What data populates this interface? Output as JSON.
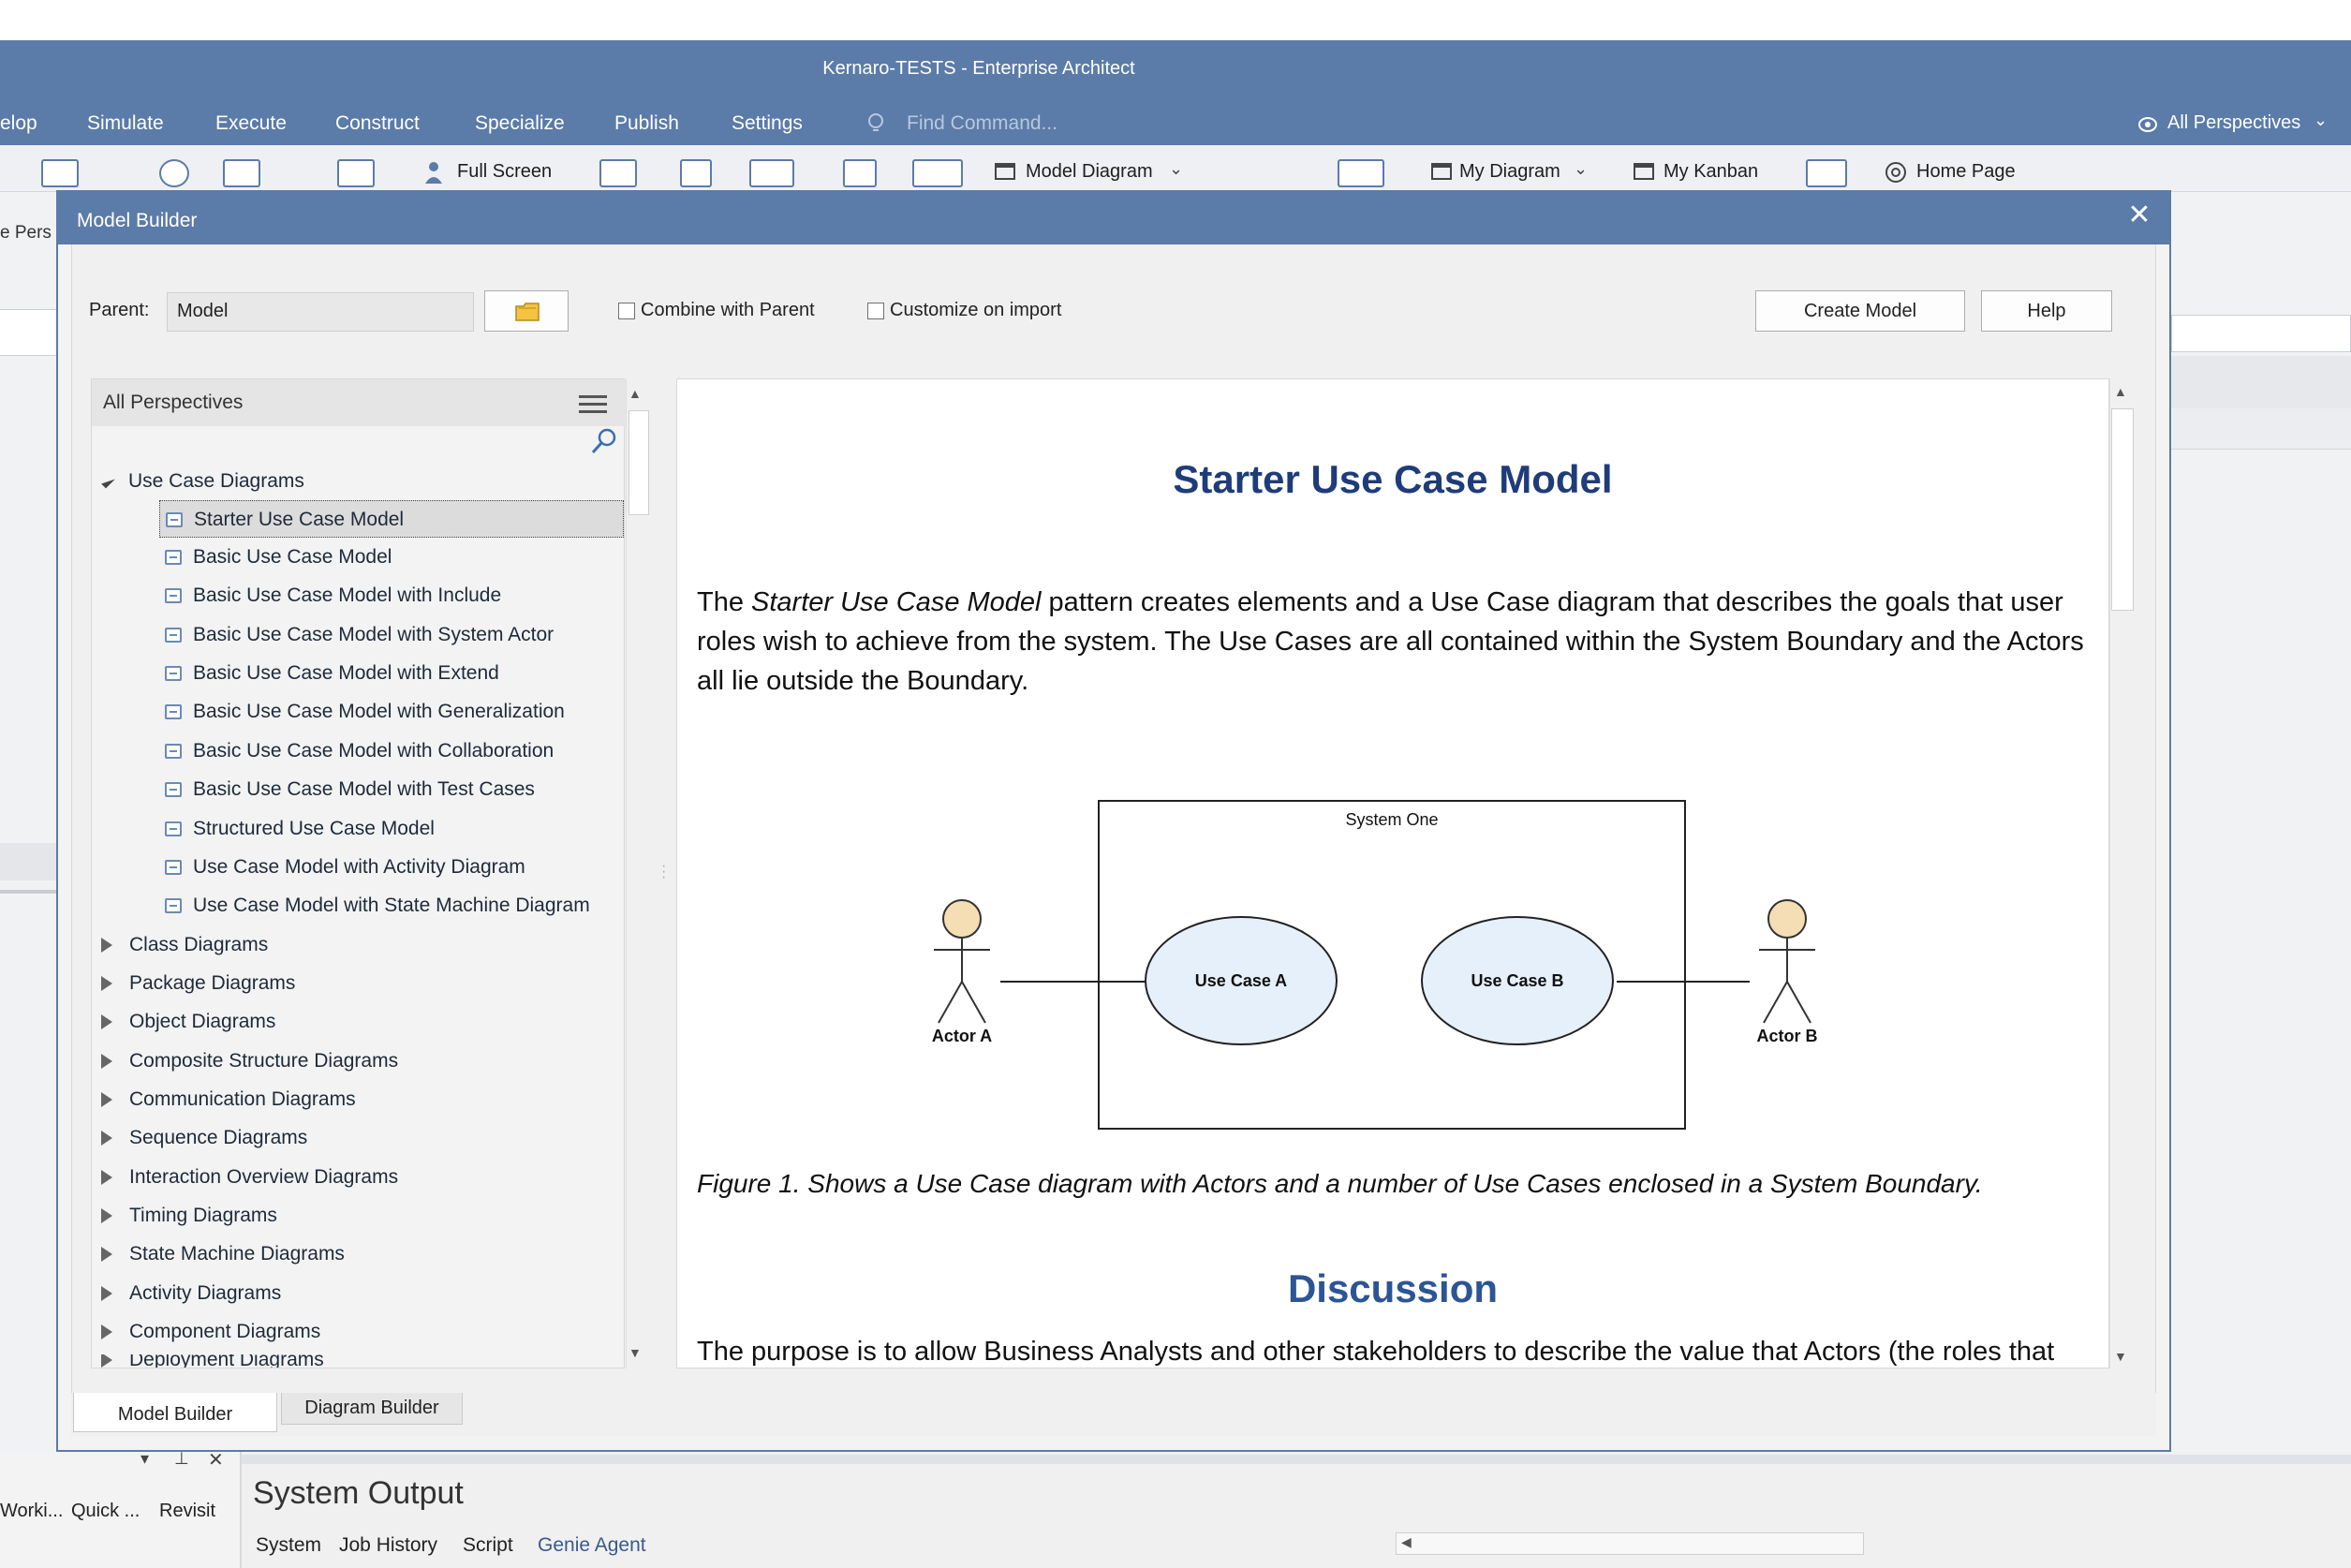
{
  "app": {
    "title": "Kernaro-TESTS - Enterprise Architect",
    "menu": [
      "elop",
      "Simulate",
      "Execute",
      "Construct",
      "Specialize",
      "Publish",
      "Settings"
    ],
    "find_command_placeholder": "Find Command...",
    "perspectives": "All Perspectives"
  },
  "ribbon": {
    "full_screen": "Full Screen",
    "model_diagram": "Model Diagram",
    "my_diagram": "My Diagram",
    "my_kanban": "My Kanban",
    "home_page": "Home Page"
  },
  "left_strip": {
    "tab": "e Pers"
  },
  "dialog": {
    "title": "Model Builder",
    "parent_label": "Parent:",
    "parent_value": "Model",
    "combine_with_parent": "Combine with Parent",
    "customize_on_import": "Customize on import",
    "create_model": "Create Model",
    "help": "Help",
    "tree": {
      "header": "All Perspectives",
      "group_expanded": "Use Case Diagrams",
      "items": [
        "Starter Use Case Model",
        "Basic Use Case Model",
        "Basic Use Case Model with Include",
        "Basic Use Case Model with System Actor",
        "Basic Use Case Model with Extend",
        "Basic Use Case Model with Generalization",
        "Basic Use Case Model with Collaboration",
        "Basic Use Case Model with Test Cases",
        "Structured Use Case Model",
        "Use Case Model with Activity Diagram",
        "Use Case Model with State Machine Diagram"
      ],
      "groups_collapsed": [
        "Class Diagrams",
        "Package Diagrams",
        "Object Diagrams",
        "Composite Structure Diagrams",
        "Communication Diagrams",
        "Sequence Diagrams",
        "Interaction Overview Diagrams",
        "Timing Diagrams",
        "State Machine Diagrams",
        "Activity Diagrams",
        "Component Diagrams",
        "Deployment Diagrams"
      ]
    },
    "doc": {
      "title": "Starter Use Case Model",
      "para_prefix": "The ",
      "para_italic": "Starter Use Case Model",
      "para_rest": " pattern creates elements and a Use Case diagram that describes the goals that user roles wish to achieve from the system. The Use Cases are all contained within the System Boundary and the Actors all lie outside the Boundary.",
      "diagram": {
        "boundary": "System One",
        "use_case_a": "Use Case A",
        "use_case_b": "Use Case B",
        "actor_a": "Actor A",
        "actor_b": "Actor B"
      },
      "caption": "Figure 1. Shows a Use Case diagram with Actors and a number of Use Cases enclosed in a System Boundary.",
      "discussion_heading": "Discussion",
      "discussion_text": "The purpose is to allow Business Analysts and other stakeholders to describe the value that Actors (the roles that"
    },
    "tabs": [
      "Model Builder",
      "Diagram Builder"
    ]
  },
  "bottom": {
    "left_tabs": [
      "Worki...",
      "Quick ...",
      "Revisit"
    ],
    "system_output": "System Output",
    "output_tabs": [
      "System",
      "Job History",
      "Script",
      "Genie Agent"
    ]
  }
}
